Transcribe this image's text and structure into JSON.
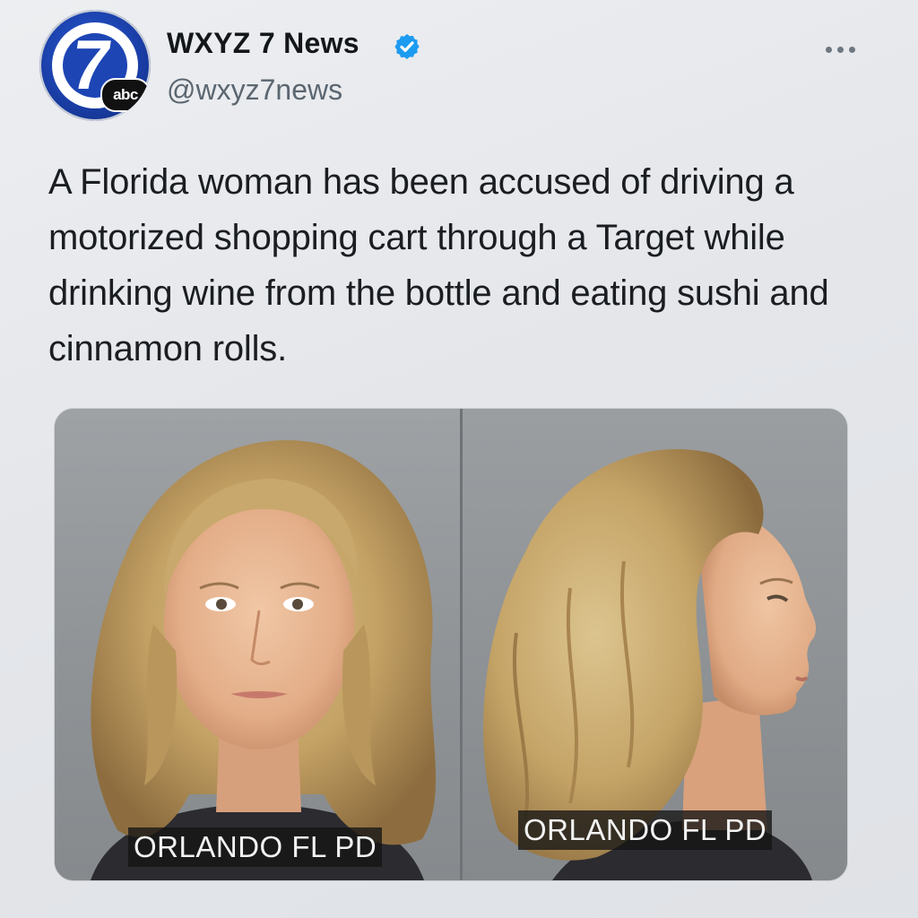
{
  "account": {
    "display_name": "WXYZ 7 News",
    "handle": "@wxyz7news",
    "verified": true,
    "avatar": {
      "digit": "7",
      "badge": "abc"
    }
  },
  "menu": {
    "icon": "more-options-icon"
  },
  "tweet": {
    "text": "A Florida woman has been accused of driving a motorized shopping cart through a Target while drinking wine from the bottle and eating sushi and cinnamon rolls."
  },
  "media": {
    "photos": [
      {
        "caption": "ORLANDO FL PD",
        "view": "front"
      },
      {
        "caption": "ORLANDO FL PD",
        "view": "profile"
      }
    ]
  },
  "colors": {
    "verified_blue": "#1d9bf0",
    "avatar_blue": "#1d45b4",
    "background": "#e6e8eb",
    "text": "#1a1d21",
    "handle": "#5b6670"
  }
}
